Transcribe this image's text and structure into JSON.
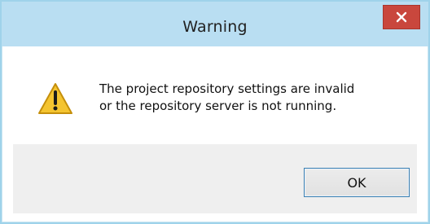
{
  "dialog": {
    "title": "Warning",
    "close_label": "×",
    "message_line1": "The project repository settings are invalid",
    "message_line2": "or the repository server is not running.",
    "ok_label": "OK",
    "icon": "warning-triangle-icon",
    "colors": {
      "titlebar": "#b9def2",
      "close_button": "#c9473d",
      "footer": "#efefef",
      "ok_border": "#3c7fb1",
      "warning_fill": "#f4c430"
    }
  }
}
